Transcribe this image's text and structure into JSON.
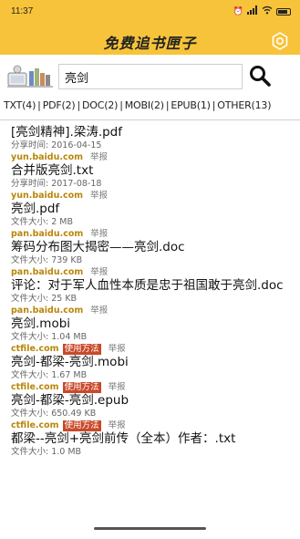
{
  "status_bar": {
    "time": "11:37"
  },
  "header": {
    "title": "免费追书匣子"
  },
  "search": {
    "query": "亮剑"
  },
  "filters": [
    {
      "label": "TXT(4)"
    },
    {
      "label": "PDF(2)"
    },
    {
      "label": "DOC(2)"
    },
    {
      "label": "MOBI(2)"
    },
    {
      "label": "EPUB(1)"
    },
    {
      "label": "OTHER(13)"
    }
  ],
  "results": [
    {
      "title": "[亮剑精神].梁涛.pdf",
      "meta": "分享时间: 2016-04-15",
      "domain": "yun.baidu.com",
      "help": "",
      "report": "举报"
    },
    {
      "title": "合并版亮剑.txt",
      "meta": "分享时间: 2017-08-18",
      "domain": "yun.baidu.com",
      "help": "",
      "report": "举报"
    },
    {
      "title": "亮剑.pdf",
      "meta": "文件大小: 2 MB",
      "domain": "pan.baidu.com",
      "help": "",
      "report": "举报"
    },
    {
      "title": "筹码分布图大揭密——亮剑.doc",
      "meta": "文件大小: 739 KB",
      "domain": "pan.baidu.com",
      "help": "",
      "report": "举报"
    },
    {
      "title": "评论：对于军人血性本质是忠于祖国敢于亮剑.doc",
      "meta": "文件大小: 25 KB",
      "domain": "pan.baidu.com",
      "help": "",
      "report": "举报"
    },
    {
      "title": "亮剑.mobi",
      "meta": "文件大小: 1.04 MB",
      "domain": "ctfile.com",
      "help": "使用方法",
      "report": "举报"
    },
    {
      "title": "亮剑-都梁-亮剑.mobi",
      "meta": "文件大小: 1.67 MB",
      "domain": "ctfile.com",
      "help": "使用方法",
      "report": "举报"
    },
    {
      "title": "亮剑-都梁-亮剑.epub",
      "meta": "文件大小: 650.49 KB",
      "domain": "ctfile.com",
      "help": "使用方法",
      "report": "举报"
    },
    {
      "title": "都梁--亮剑+亮剑前传（全本）作者：.txt",
      "meta": "文件大小: 1.0 MB",
      "domain": "",
      "help": "",
      "report": ""
    }
  ],
  "colors": {
    "header_bg": "#f7c33a",
    "domain": "#b8860b",
    "help_badge": "#c94a2a"
  }
}
